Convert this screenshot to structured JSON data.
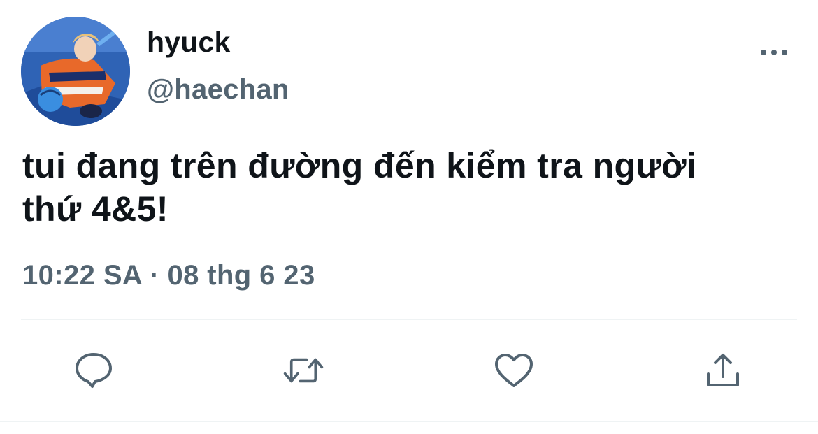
{
  "tweet": {
    "display_name": "hyuck",
    "handle": "@haechan",
    "text": "tui đang trên đường đến kiểm tra người\nthứ 4&5!",
    "timestamp": "10:22 SA · 08 thg 6 23"
  },
  "icons": {
    "more": "more-horizontal-icon",
    "reply": "reply-bubble-icon",
    "retweet": "retweet-arrows-icon",
    "like": "heart-icon",
    "share": "share-upload-icon"
  },
  "colors": {
    "primary_text": "#0f1419",
    "secondary_text": "#536471",
    "divider": "#eff3f4"
  }
}
